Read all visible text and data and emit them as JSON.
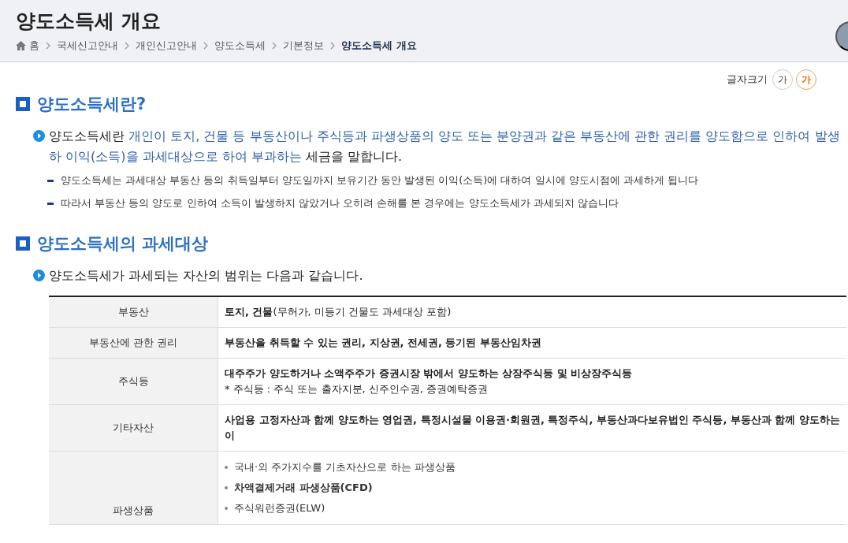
{
  "header": {
    "title": "양도소득세 개요",
    "breadcrumb": [
      {
        "label": "홈",
        "kind": "home",
        "current": false
      },
      {
        "label": "국세신고안내",
        "kind": "link",
        "current": false
      },
      {
        "label": "개인신고안내",
        "kind": "link",
        "current": false
      },
      {
        "label": "양도소득세",
        "kind": "link",
        "current": false
      },
      {
        "label": "기본정보",
        "kind": "link",
        "current": false
      },
      {
        "label": "양도소득세 개요",
        "kind": "link",
        "current": true
      }
    ]
  },
  "font_size": {
    "label": "글자크기",
    "options": [
      {
        "label": "가",
        "selected": false
      },
      {
        "label": "가",
        "selected": true
      }
    ]
  },
  "sections": [
    {
      "heading": "양도소득세란?",
      "intro": {
        "term": "양도소득세란",
        "definition": " 개인이 토지, 건물 등 부동산이나 주식등과 파생상품의 양도 또는 분양권과 같은 부동산에 관한 권리를 양도함으로 인하여 발생하 이익(소득)을 과세대상으로 하여 부과하는",
        "tail": " 세금을 말합니다."
      },
      "notes": [
        "양도소득세는 과세대상 부동산 등의 취득일부터 양도일까지 보유기간 동안 발생된 이익(소득)에 대하여 일시에 양도시점에 과세하게 됩니다",
        "따라서 부동산 등의 양도로 인하여 소득이 발생하지 않았거나 오히려 손해를 본 경우에는 양도소득세가 과세되지 않습니다"
      ]
    },
    {
      "heading": "양도소득세의 과세대상",
      "intro": {
        "term": "양도소득세가 과세되는 자산의 범위는 다음과 같습니다."
      },
      "table": {
        "rows": [
          {
            "label": "부동산",
            "kind": "text",
            "lines": [
              "**토지, 건물**(무허가, 미등기 건물도 과세대상 포함)"
            ]
          },
          {
            "label": "부동산에 관한 권리",
            "kind": "text",
            "lines": [
              "**부동산을 취득할 수 있는 권리, 지상권, 전세권, 등기된 부동산임차권**"
            ]
          },
          {
            "label": "주식등",
            "kind": "text",
            "lines": [
              "**대주주가 양도하거나 소액주주가 증권시장 밖에서 양도하는 상장주식등 및 비상장주식등**",
              "* 주식등 : 주식 또는 출자지분, 신주인수권, 증권예탁증권"
            ]
          },
          {
            "label": "기타자산",
            "kind": "text",
            "lines": [
              "**사업용 고정자산과 함께 양도하는 영업권, 특정시설물 이용권·회원권, 특정주식, 부동산과다보유법인 주식등, 부동산과 함께 양도하는 이**"
            ]
          },
          {
            "label": "파생상품",
            "kind": "bullets",
            "lines": [
              "국내·외 주가지수를 기초자산으로 하는 파생상품",
              "**차액결제거래 파생상품(CFD)**",
              "주식워런증권(ELW)"
            ]
          }
        ]
      }
    }
  ]
}
